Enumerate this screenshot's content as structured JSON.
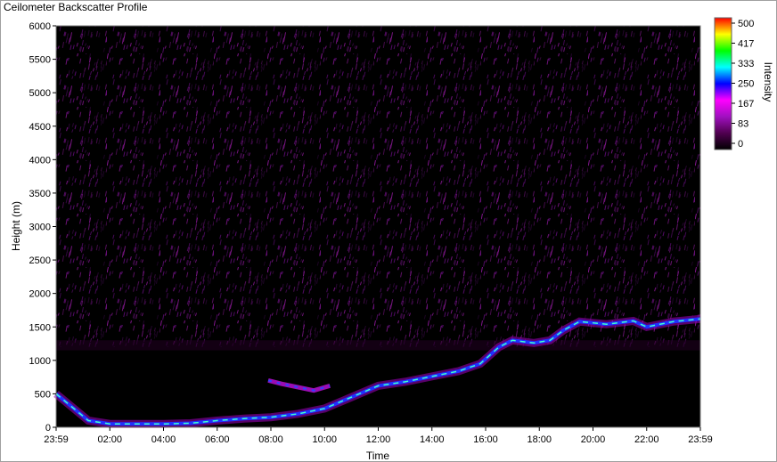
{
  "window": {
    "title": "Ceilometer Backscatter Profile"
  },
  "colors": {
    "background": "#000000",
    "scale_stops": [
      "#000000",
      "#500050",
      "#a010c0",
      "#ff00ff",
      "#0000ff",
      "#00ffff",
      "#00ff00",
      "#ffff00",
      "#ff0000"
    ]
  },
  "chart_data": {
    "type": "heatmap",
    "title": "Ceilometer Backscatter Profile",
    "xlabel": "Time",
    "ylabel": "Height (m)",
    "x_ticks": [
      "23:59",
      "02:00",
      "04:00",
      "06:00",
      "08:00",
      "10:00",
      "12:00",
      "14:00",
      "16:00",
      "18:00",
      "20:00",
      "22:00",
      "23:59"
    ],
    "y_ticks": [
      "0",
      "500",
      "1000",
      "1500",
      "2000",
      "2500",
      "3000",
      "3500",
      "4000",
      "4500",
      "5000",
      "5500",
      "6000"
    ],
    "ylim": [
      0,
      6000
    ],
    "colorbar": {
      "label": "Intensity",
      "range": [
        0,
        500
      ],
      "ticks": [
        "0",
        "83",
        "167",
        "250",
        "333",
        "417",
        "500"
      ]
    },
    "layers": [
      {
        "type": "cloud_base",
        "points": [
          {
            "t": 0.0,
            "h": 500
          },
          {
            "t": 0.6,
            "h": 300
          },
          {
            "t": 1.2,
            "h": 100
          },
          {
            "t": 2.0,
            "h": 50
          },
          {
            "t": 4.0,
            "h": 50
          },
          {
            "t": 5.0,
            "h": 60
          },
          {
            "t": 6.0,
            "h": 100
          },
          {
            "t": 7.0,
            "h": 130
          },
          {
            "t": 8.0,
            "h": 150
          },
          {
            "t": 9.0,
            "h": 200
          },
          {
            "t": 10.0,
            "h": 280
          },
          {
            "t": 11.0,
            "h": 450
          },
          {
            "t": 12.0,
            "h": 620
          },
          {
            "t": 13.0,
            "h": 680
          },
          {
            "t": 14.0,
            "h": 760
          },
          {
            "t": 15.0,
            "h": 840
          },
          {
            "t": 15.8,
            "h": 950
          },
          {
            "t": 16.5,
            "h": 1200
          },
          {
            "t": 17.0,
            "h": 1300
          },
          {
            "t": 17.8,
            "h": 1260
          },
          {
            "t": 18.4,
            "h": 1300
          },
          {
            "t": 18.9,
            "h": 1450
          },
          {
            "t": 19.5,
            "h": 1580
          },
          {
            "t": 20.5,
            "h": 1540
          },
          {
            "t": 21.5,
            "h": 1590
          },
          {
            "t": 22.0,
            "h": 1500
          },
          {
            "t": 23.0,
            "h": 1580
          },
          {
            "t": 24.0,
            "h": 1620
          }
        ]
      },
      {
        "type": "upper_blob",
        "points": [
          {
            "t": 7.9,
            "h": 700
          },
          {
            "t": 8.4,
            "h": 650
          },
          {
            "t": 9.6,
            "h": 550
          },
          {
            "t": 10.2,
            "h": 620
          }
        ]
      }
    ],
    "grid": false
  }
}
